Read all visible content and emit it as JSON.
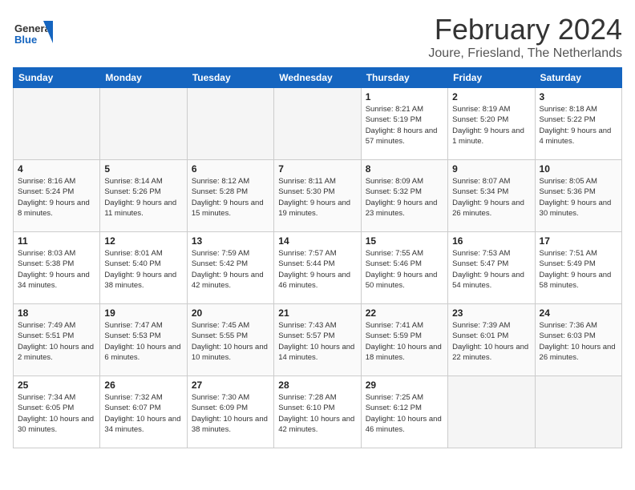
{
  "header": {
    "logo_general": "General",
    "logo_blue": "Blue",
    "month": "February 2024",
    "location": "Joure, Friesland, The Netherlands"
  },
  "weekdays": [
    "Sunday",
    "Monday",
    "Tuesday",
    "Wednesday",
    "Thursday",
    "Friday",
    "Saturday"
  ],
  "weeks": [
    [
      {
        "day": "",
        "info": "",
        "empty": true
      },
      {
        "day": "",
        "info": "",
        "empty": true
      },
      {
        "day": "",
        "info": "",
        "empty": true
      },
      {
        "day": "",
        "info": "",
        "empty": true
      },
      {
        "day": "1",
        "info": "Sunrise: 8:21 AM\nSunset: 5:19 PM\nDaylight: 8 hours\nand 57 minutes."
      },
      {
        "day": "2",
        "info": "Sunrise: 8:19 AM\nSunset: 5:20 PM\nDaylight: 9 hours\nand 1 minute."
      },
      {
        "day": "3",
        "info": "Sunrise: 8:18 AM\nSunset: 5:22 PM\nDaylight: 9 hours\nand 4 minutes."
      }
    ],
    [
      {
        "day": "4",
        "info": "Sunrise: 8:16 AM\nSunset: 5:24 PM\nDaylight: 9 hours\nand 8 minutes."
      },
      {
        "day": "5",
        "info": "Sunrise: 8:14 AM\nSunset: 5:26 PM\nDaylight: 9 hours\nand 11 minutes."
      },
      {
        "day": "6",
        "info": "Sunrise: 8:12 AM\nSunset: 5:28 PM\nDaylight: 9 hours\nand 15 minutes."
      },
      {
        "day": "7",
        "info": "Sunrise: 8:11 AM\nSunset: 5:30 PM\nDaylight: 9 hours\nand 19 minutes."
      },
      {
        "day": "8",
        "info": "Sunrise: 8:09 AM\nSunset: 5:32 PM\nDaylight: 9 hours\nand 23 minutes."
      },
      {
        "day": "9",
        "info": "Sunrise: 8:07 AM\nSunset: 5:34 PM\nDaylight: 9 hours\nand 26 minutes."
      },
      {
        "day": "10",
        "info": "Sunrise: 8:05 AM\nSunset: 5:36 PM\nDaylight: 9 hours\nand 30 minutes."
      }
    ],
    [
      {
        "day": "11",
        "info": "Sunrise: 8:03 AM\nSunset: 5:38 PM\nDaylight: 9 hours\nand 34 minutes."
      },
      {
        "day": "12",
        "info": "Sunrise: 8:01 AM\nSunset: 5:40 PM\nDaylight: 9 hours\nand 38 minutes."
      },
      {
        "day": "13",
        "info": "Sunrise: 7:59 AM\nSunset: 5:42 PM\nDaylight: 9 hours\nand 42 minutes."
      },
      {
        "day": "14",
        "info": "Sunrise: 7:57 AM\nSunset: 5:44 PM\nDaylight: 9 hours\nand 46 minutes."
      },
      {
        "day": "15",
        "info": "Sunrise: 7:55 AM\nSunset: 5:46 PM\nDaylight: 9 hours\nand 50 minutes."
      },
      {
        "day": "16",
        "info": "Sunrise: 7:53 AM\nSunset: 5:47 PM\nDaylight: 9 hours\nand 54 minutes."
      },
      {
        "day": "17",
        "info": "Sunrise: 7:51 AM\nSunset: 5:49 PM\nDaylight: 9 hours\nand 58 minutes."
      }
    ],
    [
      {
        "day": "18",
        "info": "Sunrise: 7:49 AM\nSunset: 5:51 PM\nDaylight: 10 hours\nand 2 minutes."
      },
      {
        "day": "19",
        "info": "Sunrise: 7:47 AM\nSunset: 5:53 PM\nDaylight: 10 hours\nand 6 minutes."
      },
      {
        "day": "20",
        "info": "Sunrise: 7:45 AM\nSunset: 5:55 PM\nDaylight: 10 hours\nand 10 minutes."
      },
      {
        "day": "21",
        "info": "Sunrise: 7:43 AM\nSunset: 5:57 PM\nDaylight: 10 hours\nand 14 minutes."
      },
      {
        "day": "22",
        "info": "Sunrise: 7:41 AM\nSunset: 5:59 PM\nDaylight: 10 hours\nand 18 minutes."
      },
      {
        "day": "23",
        "info": "Sunrise: 7:39 AM\nSunset: 6:01 PM\nDaylight: 10 hours\nand 22 minutes."
      },
      {
        "day": "24",
        "info": "Sunrise: 7:36 AM\nSunset: 6:03 PM\nDaylight: 10 hours\nand 26 minutes."
      }
    ],
    [
      {
        "day": "25",
        "info": "Sunrise: 7:34 AM\nSunset: 6:05 PM\nDaylight: 10 hours\nand 30 minutes."
      },
      {
        "day": "26",
        "info": "Sunrise: 7:32 AM\nSunset: 6:07 PM\nDaylight: 10 hours\nand 34 minutes."
      },
      {
        "day": "27",
        "info": "Sunrise: 7:30 AM\nSunset: 6:09 PM\nDaylight: 10 hours\nand 38 minutes."
      },
      {
        "day": "28",
        "info": "Sunrise: 7:28 AM\nSunset: 6:10 PM\nDaylight: 10 hours\nand 42 minutes."
      },
      {
        "day": "29",
        "info": "Sunrise: 7:25 AM\nSunset: 6:12 PM\nDaylight: 10 hours\nand 46 minutes."
      },
      {
        "day": "",
        "info": "",
        "empty": true
      },
      {
        "day": "",
        "info": "",
        "empty": true
      }
    ]
  ]
}
